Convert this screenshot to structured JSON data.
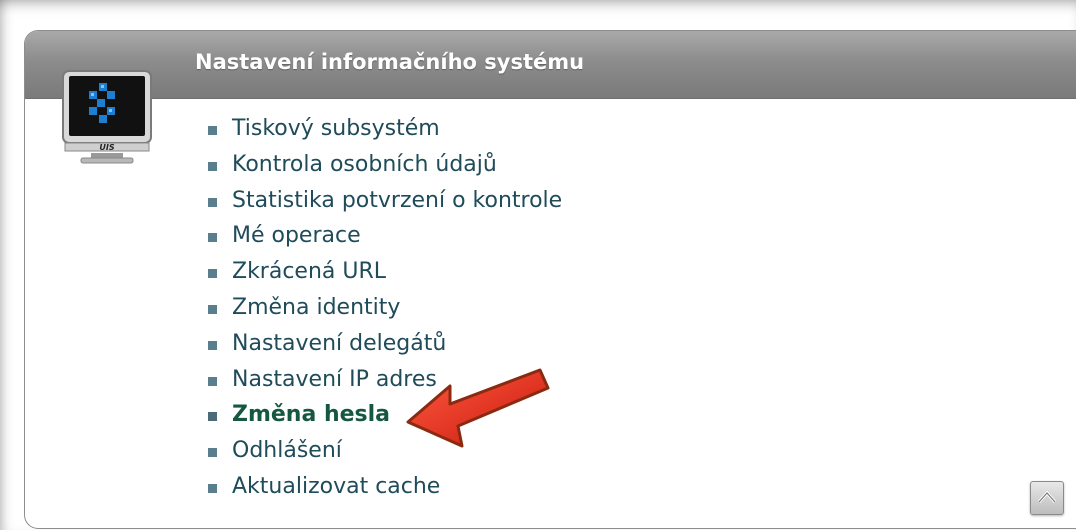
{
  "panel": {
    "title": "Nastavení informačního systému",
    "logo_text": "UIS"
  },
  "menu": {
    "items": [
      {
        "label": "Tiskový subsystém",
        "active": false
      },
      {
        "label": "Kontrola osobních údajů",
        "active": false
      },
      {
        "label": "Statistika potvrzení o kontrole",
        "active": false
      },
      {
        "label": "Mé operace",
        "active": false
      },
      {
        "label": "Zkrácená URL",
        "active": false
      },
      {
        "label": "Změna identity",
        "active": false
      },
      {
        "label": "Nastavení delegátů",
        "active": false
      },
      {
        "label": "Nastavení IP adres",
        "active": false
      },
      {
        "label": "Změna hesla",
        "active": true
      },
      {
        "label": "Odhlášení",
        "active": false
      },
      {
        "label": "Aktualizovat cache",
        "active": false
      }
    ]
  },
  "icons": {
    "logo": "monitor-icon",
    "scroll": "chevron-up-icon",
    "annotation": "red-arrow-icon"
  },
  "colors": {
    "header_gray": "#8c8c8c",
    "link": "#1f4b5a",
    "active_link": "#15583f",
    "arrow_red": "#e02b1c"
  }
}
